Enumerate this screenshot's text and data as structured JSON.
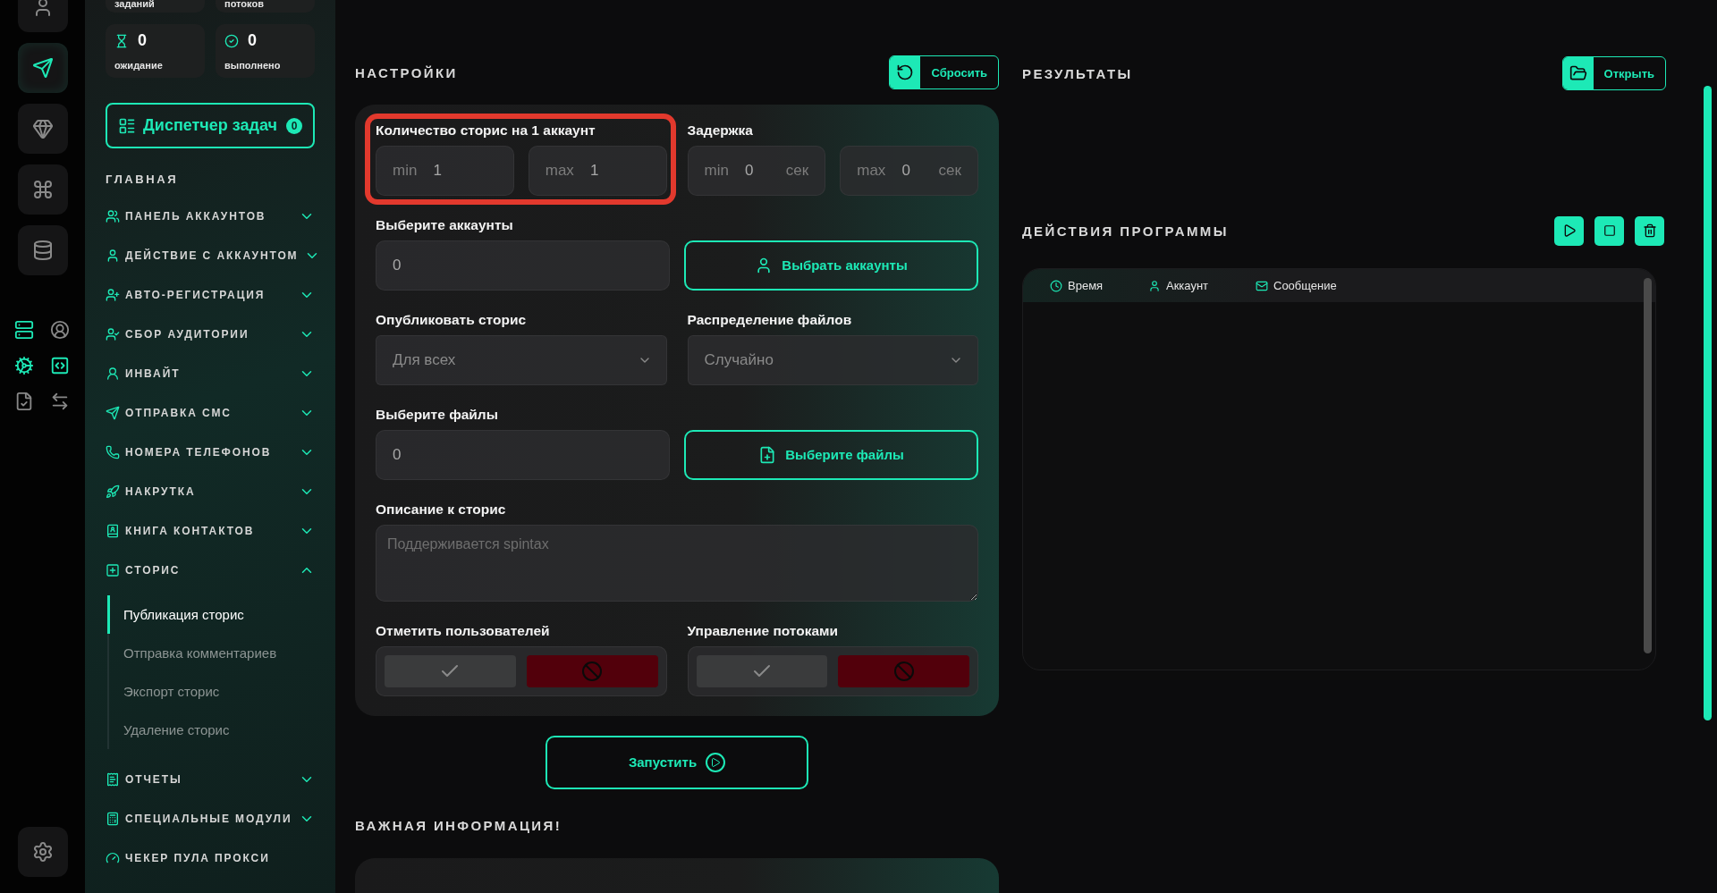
{
  "rail": [
    {
      "selected": false
    },
    {
      "selected": true
    },
    {
      "selected": false
    },
    {
      "selected": false
    },
    {
      "selected": false
    }
  ],
  "stats_top": [
    {
      "label": "заданий"
    },
    {
      "label": "потоков"
    }
  ],
  "stats": [
    {
      "value": "0",
      "label": "ожидание"
    },
    {
      "value": "0",
      "label": "выполнено"
    }
  ],
  "task_manager": {
    "label": "Диспетчер задач",
    "count": "0"
  },
  "nav": {
    "heading": "ГЛАВНАЯ",
    "items": [
      {
        "kind": "group",
        "label": "ПАНЕЛЬ АККАУНТОВ",
        "expanded": false
      },
      {
        "kind": "group",
        "label": "ДЕЙСТВИЕ С АККАУНТОМ",
        "expanded": false
      },
      {
        "kind": "group",
        "label": "АВТО-РЕГИСТРАЦИЯ",
        "expanded": false
      },
      {
        "kind": "group",
        "label": "СБОР АУДИТОРИИ",
        "expanded": false
      },
      {
        "kind": "group",
        "label": "ИНВАЙТ",
        "expanded": false
      },
      {
        "kind": "group",
        "label": "ОТПРАВКА СМС",
        "expanded": false
      },
      {
        "kind": "group",
        "label": "НОМЕРА ТЕЛЕФОНОВ",
        "expanded": false
      },
      {
        "kind": "group",
        "label": "НАКРУТКА",
        "expanded": false
      },
      {
        "kind": "group",
        "label": "КНИГА КОНТАКТОВ",
        "expanded": false
      },
      {
        "kind": "group",
        "label": "СТОРИС",
        "expanded": true,
        "children": [
          {
            "label": "Публикация сторис",
            "selected": true
          },
          {
            "label": "Отправка комментариев",
            "selected": false
          },
          {
            "label": "Экспорт сторис",
            "selected": false
          },
          {
            "label": "Удаление сторис",
            "selected": false
          }
        ]
      },
      {
        "kind": "group",
        "label": "ОТЧЕТЫ",
        "expanded": false
      },
      {
        "kind": "group",
        "label": "СПЕЦИАЛЬНЫЕ МОДУЛИ",
        "expanded": false
      },
      {
        "kind": "link",
        "label": "ЧЕКЕР ПУЛА ПРОКСИ"
      }
    ]
  },
  "settings": {
    "title": "НАСТРОЙКИ",
    "reset_button": "Сбросить",
    "fields": [
      {
        "kind": "range",
        "label": "Количество сторис на 1 аккаунт",
        "highlighted": true,
        "inputs": [
          {
            "prefix": "min",
            "value": "1"
          },
          {
            "prefix": "max",
            "value": "1"
          }
        ]
      },
      {
        "kind": "range",
        "label": "Задержка",
        "highlighted": false,
        "inputs": [
          {
            "prefix": "min",
            "value": "0",
            "suffix": "сек"
          },
          {
            "prefix": "max",
            "value": "0",
            "suffix": "сек"
          }
        ]
      },
      {
        "kind": "picker",
        "label": "Выберите аккаунты",
        "value": "0",
        "button": "Выбрать аккаунты"
      },
      {
        "kind": "select",
        "label": "Опубликовать сторис",
        "value": "Для всех"
      },
      {
        "kind": "select",
        "label": "Распределение файлов",
        "value": "Случайно"
      },
      {
        "kind": "picker",
        "label": "Выберите файлы",
        "value": "0",
        "button": "Выберите файлы"
      },
      {
        "kind": "textarea",
        "label": "Описание к сторис",
        "placeholder": "Поддерживается spintax"
      },
      {
        "kind": "toggle",
        "label": "Отметить пользователей",
        "on": false
      },
      {
        "kind": "toggle",
        "label": "Управление потоками",
        "on": false
      }
    ]
  },
  "launch_button": "Запустить",
  "important_title": "ВАЖНАЯ ИНФОРМАЦИЯ!",
  "results": {
    "title": "РЕЗУЛЬТАТЫ",
    "open_button": "Открыть"
  },
  "actions": {
    "title": "ДЕЙСТВИЯ ПРОГРАММЫ",
    "log_columns": [
      "Время",
      "Аккаунт",
      "Сообщение"
    ]
  }
}
